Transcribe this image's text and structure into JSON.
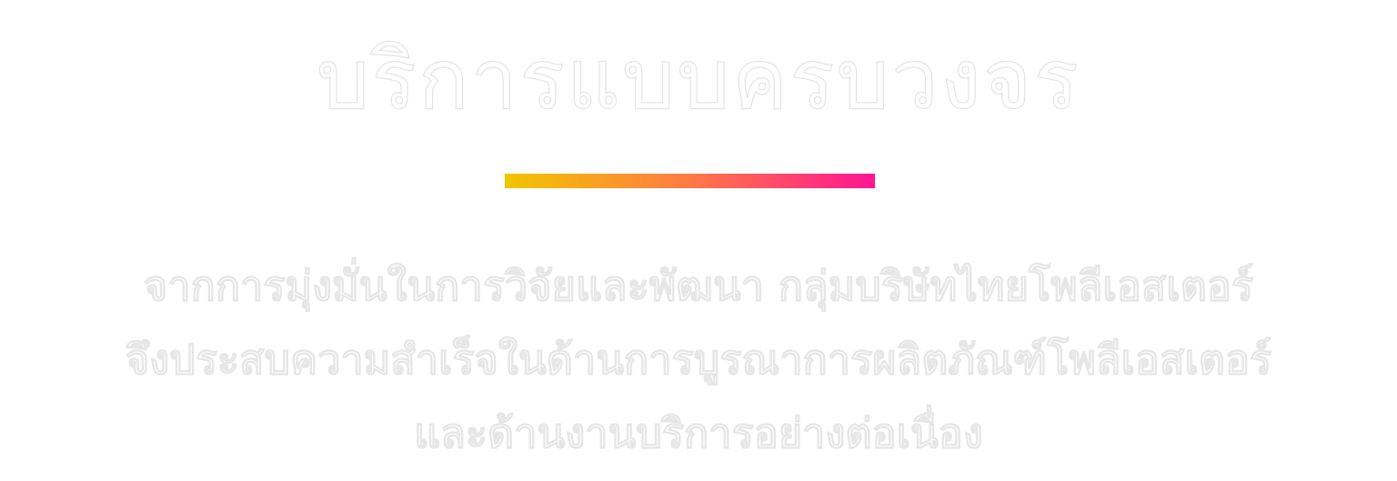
{
  "heading": {
    "title": "บริการแบบครบวงจร"
  },
  "accent": {
    "gradient_start": "#f2c500",
    "gradient_mid": "#ff7a45",
    "gradient_end": "#ff1493"
  },
  "description": {
    "lines": [
      "จากการมุ่งมั่นในการวิจัยและพัฒนา กลุ่มบริษัทไทยโพลีเอสเตอร์",
      "จึงประสบความสำเร็จในด้านการบูรณาการผลิตภัณฑ์โพลีเอสเตอร์",
      "และด้านงานบริการอย่างต่อเนื่อง"
    ]
  }
}
